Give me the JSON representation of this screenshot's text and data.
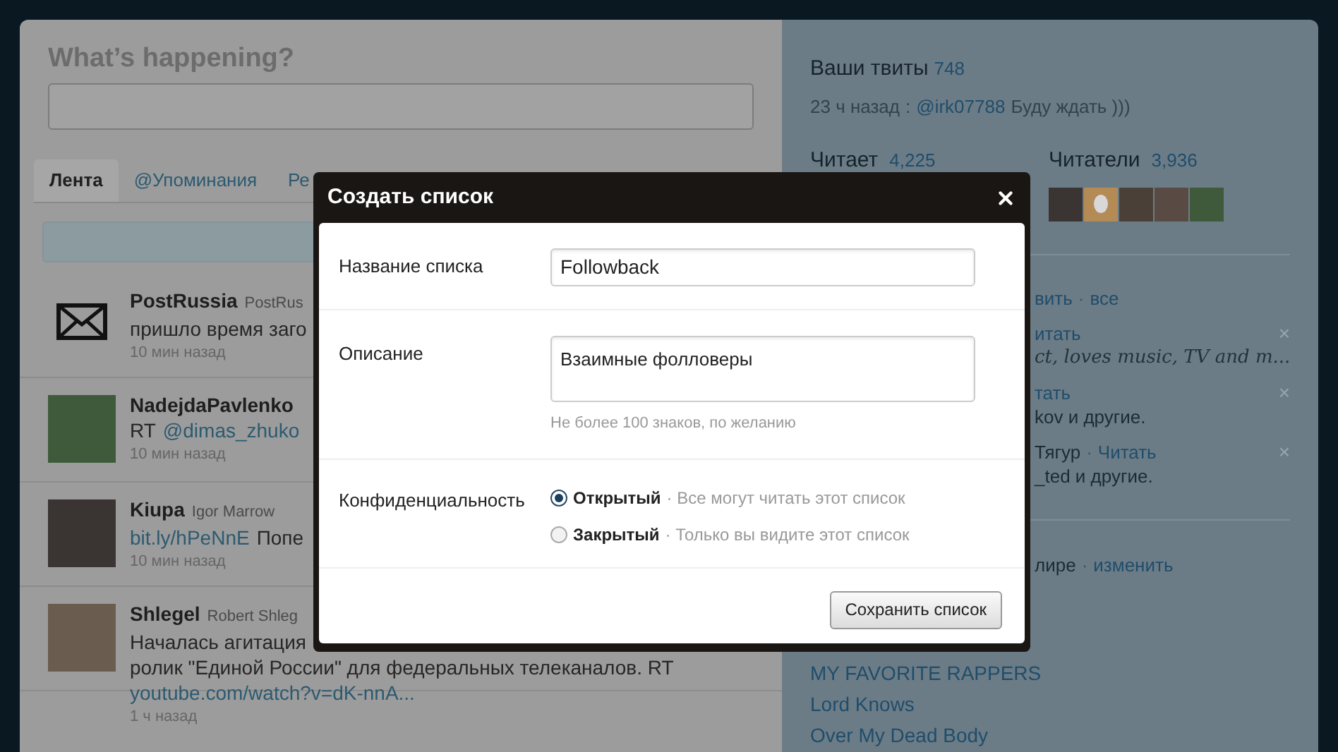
{
  "composer": {
    "title": "What’s happening?"
  },
  "tabs": [
    {
      "label": "Лента",
      "selected": true
    },
    {
      "label": "@Упоминания",
      "selected": false
    },
    {
      "label": "Ре",
      "selected": false
    }
  ],
  "tweets": [
    {
      "kind": "envelope",
      "name": "PostRussia",
      "screen_name": "PostRus",
      "lines": [
        [
          {
            "kind": "text",
            "text": "пришло время заго"
          }
        ]
      ],
      "time": "10 мин назад"
    },
    {
      "kind": "photo",
      "name": "NadejdaPavlenko",
      "lines": [
        [
          {
            "kind": "text",
            "text": "RT"
          },
          {
            "kind": "link",
            "text": "@dimas_zhuko"
          }
        ]
      ],
      "time": "10 мин назад"
    },
    {
      "kind": "photo",
      "name": "Kiupa",
      "screen_name": "Igor Marrow",
      "lines": [
        [
          {
            "kind": "link",
            "text": "bit.ly/hPeNnE"
          },
          {
            "kind": "text",
            "text": "Попе"
          }
        ]
      ],
      "time": "10 мин назад"
    },
    {
      "kind": "photo",
      "name": "Shlegel",
      "screen_name": "Robert Shleg",
      "lines": [
        [
          {
            "kind": "text",
            "text": "Началась агитация"
          }
        ],
        [
          {
            "kind": "text",
            "text": "ролик \"Единой России\" для федеральных телеканалов. RT"
          }
        ],
        [
          {
            "kind": "link",
            "text": "youtube.com/watch?v=dK-nnA..."
          }
        ]
      ],
      "time": "1 ч назад"
    }
  ],
  "sidebar": {
    "tweets_label": "Ваши твиты",
    "tweets_count": "748",
    "last_tweet": {
      "time": "23 ч назад",
      "separator": ":",
      "mention": "@irk07788",
      "text": "Буду ждать )))"
    },
    "following": {
      "label": "Читает",
      "count": "4,225"
    },
    "followers": {
      "label": "Читатели",
      "count": "3,936"
    },
    "partial_rows": [
      {
        "segments": [
          {
            "kind": "link",
            "text": "вить"
          },
          {
            "kind": "sep",
            "text": "·"
          },
          {
            "kind": "link",
            "text": "все"
          }
        ]
      },
      {
        "segments": [
          {
            "kind": "link",
            "text": "итать"
          },
          {
            "kind": "close",
            "text": "×"
          }
        ]
      },
      {
        "segments": [
          {
            "kind": "italic",
            "text": "ct, loves music, TV and m..."
          }
        ]
      },
      {
        "segments": [
          {
            "kind": "link",
            "text": "тать"
          },
          {
            "kind": "close",
            "text": "×"
          }
        ]
      },
      {
        "segments": [
          {
            "kind": "text",
            "text": "kov и другие."
          }
        ]
      },
      {
        "segments": [
          {
            "kind": "text",
            "text": "Тягур"
          },
          {
            "kind": "sep",
            "text": "·"
          },
          {
            "kind": "link",
            "text": "Читать"
          },
          {
            "kind": "close",
            "text": "×"
          }
        ]
      },
      {
        "segments": [
          {
            "kind": "text",
            "text": "_ted и другие."
          }
        ]
      }
    ],
    "location_row": [
      {
        "kind": "text",
        "text": "лире"
      },
      {
        "kind": "sep",
        "text": "·"
      },
      {
        "kind": "link",
        "text": "изменить"
      }
    ],
    "lists": [
      "MY FAVORITE RAPPERS",
      "Lord Knows",
      "Over My Dead Body"
    ]
  },
  "dialog": {
    "title": "Создать список",
    "fields": [
      {
        "kind": "input",
        "label": "Название списка",
        "value": "Followback"
      },
      {
        "kind": "textarea",
        "label": "Описание",
        "value": "Взаимные фолловеры",
        "hint": "Не более 100 знаков, по желанию"
      },
      {
        "kind": "radio",
        "label": "Конфиденциальность",
        "options": [
          {
            "label": "Открытый",
            "note": "· Все могут читать этот список",
            "selected": true
          },
          {
            "label": "Закрытый",
            "note": "· Только вы видите этот список",
            "selected": false
          }
        ]
      }
    ],
    "button": "Сохранить список"
  }
}
